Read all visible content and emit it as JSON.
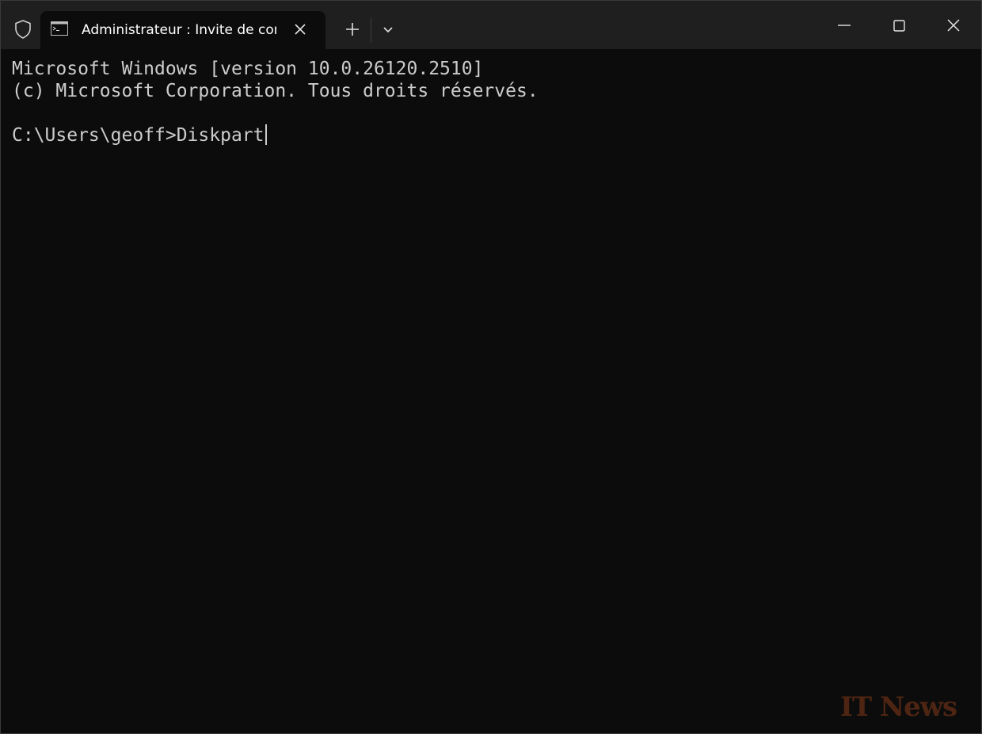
{
  "window": {
    "tab_title": "Administrateur : Invite de con",
    "icons": {
      "shield": "shield-icon",
      "tab": "command-prompt-icon",
      "tab_close": "close-icon",
      "new_tab": "plus-icon",
      "dropdown": "chevron-down-icon",
      "minimize": "minimize-icon",
      "maximize": "maximize-icon",
      "close": "close-icon"
    }
  },
  "terminal": {
    "lines": [
      "Microsoft Windows [version 10.0.26120.2510]",
      "(c) Microsoft Corporation. Tous droits réservés.",
      "",
      "C:\\Users\\geoff>Diskpart"
    ]
  },
  "watermark": "IT News",
  "colors": {
    "background": "#0c0c0c",
    "titlebar": "#1f1f1f",
    "text": "#cccccc",
    "tab_text": "#ffffff",
    "watermark": "#5a2a14"
  }
}
